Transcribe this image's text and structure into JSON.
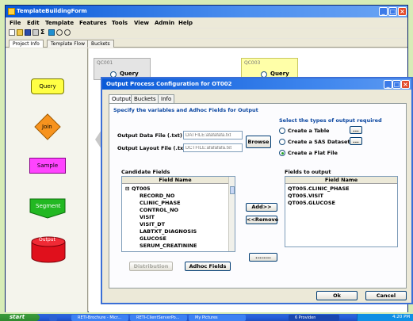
{
  "app": {
    "title": "TemplateBuildingForm",
    "menu": [
      "File",
      "Edit",
      "Template",
      "Features",
      "Tools",
      "View",
      "Admin",
      "Help"
    ],
    "tabs": [
      "Project Info",
      "Template Flow",
      "Buckets"
    ]
  },
  "palette": {
    "query": "Query",
    "join": "Join",
    "sample": "Sample",
    "segment": "Segment",
    "output": "Output"
  },
  "canvas": {
    "node1": {
      "id": "QC001",
      "label": "Query"
    },
    "node2": {
      "id": "QC003",
      "label": "Query"
    }
  },
  "dialog": {
    "title": "Output Process Configuration for OT002",
    "tabs": [
      "Output",
      "Buckets",
      "Info"
    ],
    "heading": "Specify the variables and Adhoc Fields for Output",
    "data_file_label": "Output Data File (.txt)",
    "data_file_placeholder": "DATFILE:afafafafa.txt",
    "layout_file_label": "Output Layout File (.txt)",
    "layout_file_placeholder": "DCTFILE:afafafafa.txt",
    "browse": "Browse",
    "output_types_header": "Select the types of output required",
    "output_types": [
      {
        "label": "Create a Table",
        "selected": false
      },
      {
        "label": "Create a SAS Dataset",
        "selected": false
      },
      {
        "label": "Create a Flat File",
        "selected": true
      }
    ],
    "small_button": "...",
    "candidate_title": "Candidate Fields",
    "candidate_col": "Field Name",
    "candidate_root": "QT005",
    "candidate_fields": [
      "RECORD_NO",
      "CLINIC_PHASE",
      "CONTROL_NO",
      "VISIT",
      "VISIT_DT",
      "LABTXT_DIAGNOSIS",
      "GLUCOSE",
      "SERUM_CREATININE"
    ],
    "add": "Add>>",
    "remove": "<<Remove",
    "dots": "........",
    "output_fields_title": "Fields to output",
    "output_col": "Field Name",
    "output_fields": [
      "QT005.CLINIC_PHASE",
      "QT005.VISIT",
      "QT005.GLUCOSE"
    ],
    "distribution": "Distribution",
    "adhoc": "Adhoc Fields",
    "ok": "Ok",
    "cancel": "Cancel"
  },
  "taskbar": {
    "start": "start",
    "tasks": [
      "RETI-Brochure - Micr...",
      "RETI-ClientServerPo...",
      "My Pictures",
      "6 Providen"
    ],
    "clock": "4:20 PM"
  },
  "colors": {
    "accent": "#0a5ad8",
    "query": "#ffff44",
    "join": "#f7931e",
    "sample": "#ff44ff",
    "segment": "#22b822",
    "output": "#e0101c"
  }
}
